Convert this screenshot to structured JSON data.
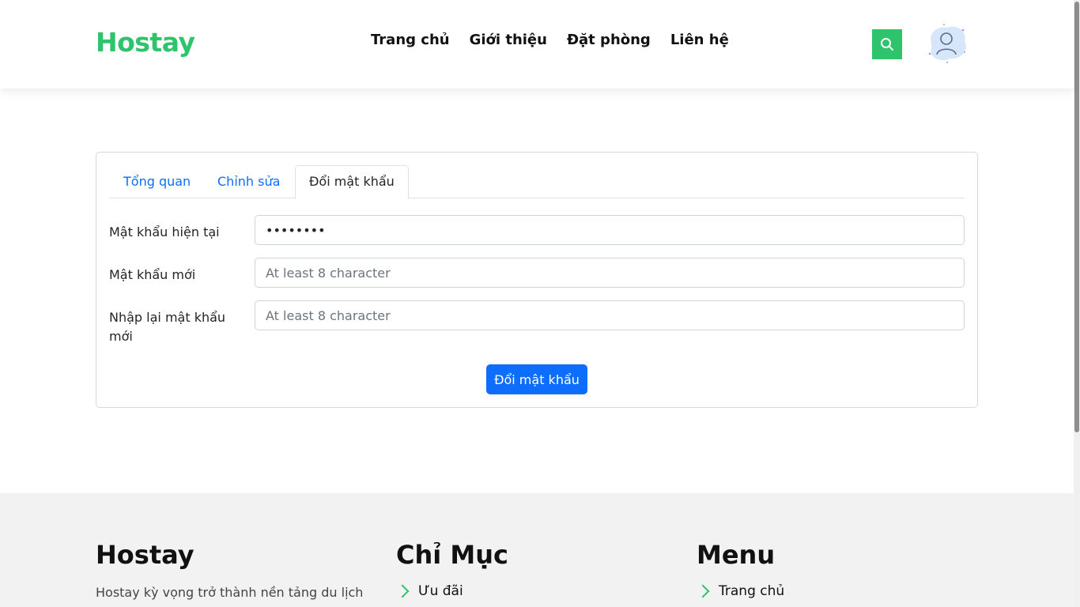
{
  "header": {
    "logo": "Hostay",
    "nav": [
      "Trang chủ",
      "Giới thiệu",
      "Đặt phòng",
      "Liên hệ"
    ],
    "icons": {
      "search": "search-icon",
      "avatar": "user-avatar-icon"
    },
    "colors": {
      "brand": "#2ec46b"
    }
  },
  "profile": {
    "tabs": [
      {
        "label": "Tổng quan",
        "active": false
      },
      {
        "label": "Chỉnh sửa",
        "active": false
      },
      {
        "label": "Đổi mật khẩu",
        "active": true
      }
    ],
    "form": {
      "current_password": {
        "label": "Mật khẩu hiện tại",
        "value": "••••••••",
        "placeholder": ""
      },
      "new_password": {
        "label": "Mật khẩu mới",
        "value": "",
        "placeholder": "At least 8 character"
      },
      "confirm_password": {
        "label": "Nhập lại mật khẩu mới",
        "value": "",
        "placeholder": "At least 8 character"
      },
      "submit_label": "Đổi mật khẩu"
    },
    "colors": {
      "primary": "#0d6efd"
    }
  },
  "footer": {
    "about": {
      "title": "Hostay",
      "description": "Hostay kỳ vọng trở thành nền tảng du lịch"
    },
    "index": {
      "title": "Chỉ Mục",
      "items": [
        "Ưu đãi"
      ]
    },
    "menu": {
      "title": "Menu",
      "items": [
        "Trang chủ"
      ]
    }
  }
}
